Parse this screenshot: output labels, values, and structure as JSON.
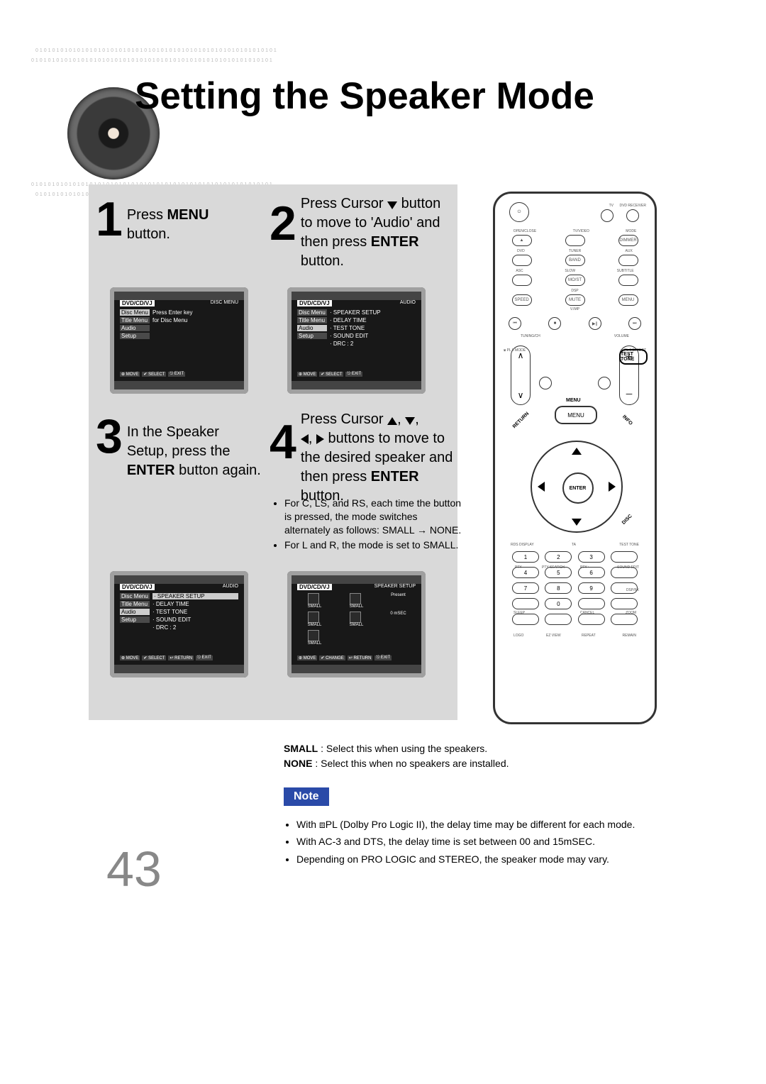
{
  "title": "Setting the Speaker Mode",
  "page_number": "43",
  "speaker_ring": "0101010101010101010101010101010101010101010101010101010101",
  "steps": {
    "s1": {
      "num": "1",
      "a": "Press ",
      "b": "MENU",
      "c": " button."
    },
    "s2": {
      "num": "2",
      "a": "Press Cursor ",
      "b": "button to move to 'Audio' and then press ",
      "c": "ENTER",
      "d": " button."
    },
    "s3": {
      "num": "3",
      "a": "In the Speaker Setup, press the ",
      "b": "ENTER",
      "c": " button again."
    },
    "s4": {
      "num": "4",
      "a": "Press Cursor ",
      "b": " buttons to move to the desired speaker and then press ",
      "c": "ENTER",
      "d": " button."
    }
  },
  "sub4": [
    "For C, LS, and RS, each time the button is pressed, the mode switches alternately as follows: SMALL → NONE.",
    "For L and R, the mode is set to SMALL."
  ],
  "osd": {
    "disc_menu_hdr_l": "DVD/CD/VJ",
    "disc_menu_hdr_r": "DISC MENU",
    "audio_hdr_r": "AUDIO",
    "speaker_hdr_r": "SPEAKER SETUP",
    "side": [
      "Disc Menu",
      "Title Menu",
      "Audio",
      "Setup"
    ],
    "line_press": "Press Enter key",
    "line_for": "for Disc Menu",
    "audio_items": [
      "SPEAKER SETUP",
      "DELAY TIME",
      "TEST TONE",
      "SOUND EDIT",
      "DRC          : 2"
    ],
    "ftr_move": "⊕ MOVE",
    "ftr_select": "✔ SELECT",
    "ftr_return": "↩ RETURN",
    "ftr_change": "✔ CHANGE",
    "ftr_exit": "⎋ EXIT",
    "spk_labels": [
      "SMALL",
      "SMALL",
      "Present",
      "SMALL",
      "SMALL",
      "0 mSEC",
      "SMALL"
    ]
  },
  "remote": {
    "row_top": [
      "TV",
      "DVD RECEIVER"
    ],
    "row2": [
      "OPEN/CLOSE",
      "TV/VIDEO",
      "MODE"
    ],
    "row2b": [
      "▲",
      "",
      "DIMMER"
    ],
    "row3": [
      "DVD",
      "TUNER",
      "AUX"
    ],
    "row3b": [
      "",
      "BAND",
      ""
    ],
    "row4": [
      "ASC",
      "SLOW",
      "SUBTITLE"
    ],
    "row4b": [
      "",
      "MO/ST",
      ""
    ],
    "row5_label": "DSP",
    "row5": [
      "SPEED",
      "MUTE",
      "MENU"
    ],
    "row5b": "V.IMP",
    "transport": [
      "⏮",
      "■",
      "▶∥",
      "⏭"
    ],
    "tuning": "TUNING/CH",
    "volume": "VOLUME",
    "plii_mode": "⧈ PL II MODE",
    "plii_effect": "⧈ PL II EFFECT",
    "ring_menu": "MENU",
    "ring_info": "INFO",
    "ring_return": "RETURN",
    "ring_disc": "DISC",
    "enter": "ENTER",
    "numtop": [
      "RDS DISPLAY",
      "TA",
      "TEST TONE"
    ],
    "nummid": [
      "PTY",
      "PTY SEARCH",
      "PTY+",
      "SOUND EDIT"
    ],
    "numbot": [
      "SLEEP",
      "",
      "CANCEL",
      "ZOOM"
    ],
    "numlast": [
      "LOGO",
      "EZ VIEW",
      "REPEAT",
      "REMAIN"
    ],
    "dsp_fx": "DSP/FX"
  },
  "definitions": {
    "small_l": "SMALL",
    "small_t": " : Select this when using the speakers.",
    "none_l": "NONE",
    "none_t": " : Select this when no speakers are installed."
  },
  "note_label": "Note",
  "notes": [
    "With ⧈PL (Dolby Pro Logic II), the delay time may be different for each mode.",
    "With AC-3 and DTS, the delay time is set between 00 and 15mSEC.",
    "Depending on PRO LOGIC and STEREO, the speaker mode may vary."
  ]
}
